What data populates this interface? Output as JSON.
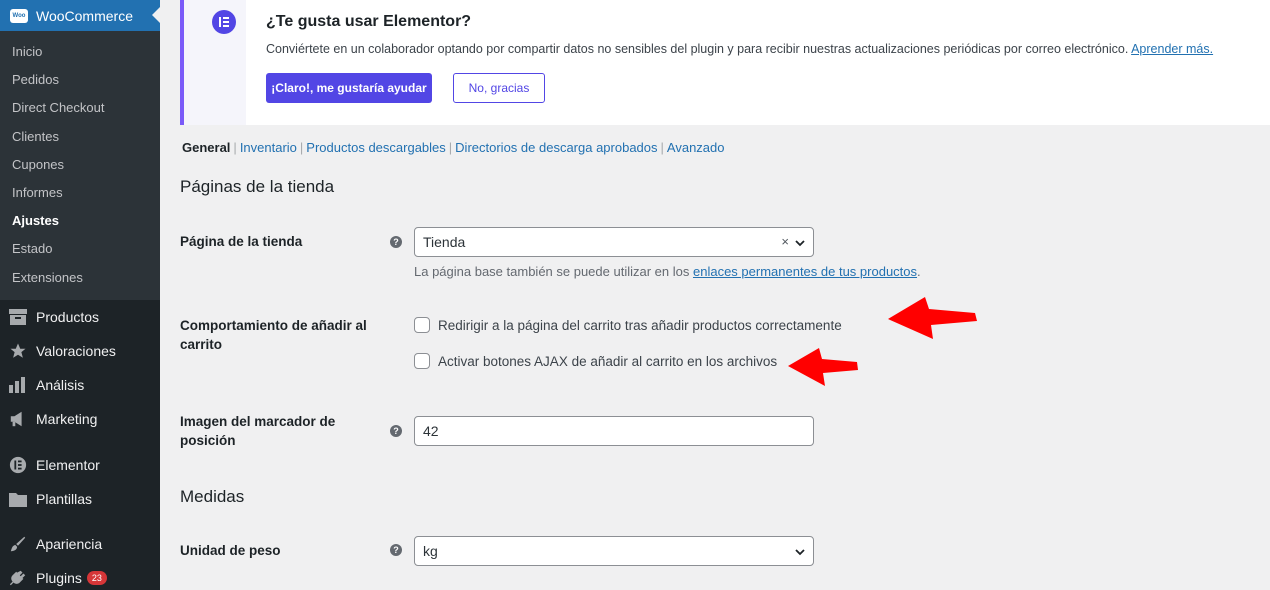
{
  "sidebar": {
    "header": "WooCommerce",
    "logo_text": "Woo",
    "submenu": [
      "Inicio",
      "Pedidos",
      "Direct Checkout",
      "Clientes",
      "Cupones",
      "Informes",
      "Ajustes",
      "Estado",
      "Extensiones"
    ],
    "menu": [
      {
        "label": "Productos",
        "icon": "archive-icon"
      },
      {
        "label": "Valoraciones",
        "icon": "star-icon"
      },
      {
        "label": "Análisis",
        "icon": "bar-chart-icon"
      },
      {
        "label": "Marketing",
        "icon": "megaphone-icon"
      },
      {
        "label": "Elementor",
        "icon": "elementor-icon"
      },
      {
        "label": "Plantillas",
        "icon": "folder-icon"
      },
      {
        "label": "Apariencia",
        "icon": "paintbrush-icon"
      },
      {
        "label": "Plugins",
        "icon": "plug-icon",
        "badge": "23"
      }
    ]
  },
  "notice": {
    "title": "¿Te gusta usar Elementor?",
    "text": "Conviértete en un colaborador optando por compartir datos no sensibles del plugin y para recibir nuestras actualizaciones periódicas por correo electrónico.",
    "link": "Aprender más.",
    "accept": "¡Claro!, me gustaría ayudar",
    "decline": "No, gracias"
  },
  "subnav": {
    "current": "General",
    "links": [
      "Inventario",
      "Productos descargables",
      "Directorios de descarga aprobados",
      "Avanzado"
    ]
  },
  "shop_pages": {
    "title": "Páginas de la tienda",
    "shop_page_label": "Página de la tienda",
    "shop_page_value": "Tienda",
    "desc_prefix": "La página base también se puede utilizar en los",
    "desc_link": "enlaces permanentes de tus productos",
    "desc_suffix": ".",
    "cart_label": "Comportamiento de añadir al carrito",
    "cart_option_1": "Redirigir a la página del carrito tras añadir productos correctamente",
    "cart_option_2": "Activar botones AJAX de añadir al carrito en los archivos",
    "placeholder_label": "Imagen del marcador de posición",
    "placeholder_value": "42"
  },
  "measures": {
    "title": "Medidas",
    "weight_label": "Unidad de peso",
    "weight_value": "kg"
  },
  "colors": {
    "sidebar": "#1d2327",
    "accent": "#2271b1",
    "elementor": "#5246e5",
    "arrow": "#ff0000"
  }
}
